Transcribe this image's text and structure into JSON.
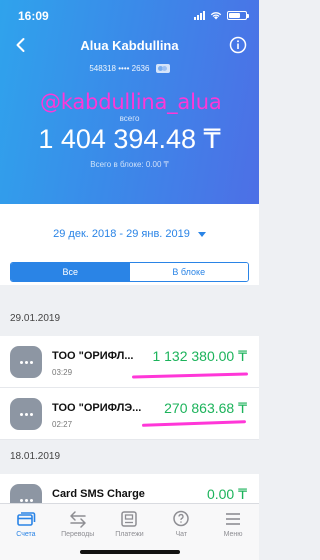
{
  "status_bar": {
    "time": "16:09"
  },
  "header": {
    "title": "Alua Kabdullina",
    "card_number": "548318 •••• 2636",
    "watermark": "@kabdullina_alua",
    "total_label": "всего",
    "balance": "1 404 394.48 ₸",
    "blocked_text": "Всего в блоке: 0.00 ₸"
  },
  "filter": {
    "date_range": "29 дек. 2018 - 29 янв. 2019",
    "segments": [
      "Все",
      "В блоке"
    ],
    "active_segment": 0
  },
  "transactions": {
    "groups": [
      {
        "date": "29.01.2019",
        "items": [
          {
            "name": "ТОО \"ОРИФЛ...",
            "time": "03:29",
            "amount": "1 132 380.00 ₸"
          },
          {
            "name": "ТОО \"ОРИФЛЭ...",
            "time": "02:27",
            "amount": "270 863.68 ₸"
          }
        ]
      },
      {
        "date": "18.01.2019",
        "items": [
          {
            "name": "Card SMS Charge",
            "time": "",
            "amount": "0.00 ₸"
          }
        ]
      }
    ]
  },
  "colors": {
    "accent": "#2a84e6",
    "positive_amount": "#1cb35b",
    "annotation": "#ff37d8"
  },
  "tabbar": {
    "tabs": [
      {
        "label": "Счета",
        "icon": "cards-icon"
      },
      {
        "label": "Переводы",
        "icon": "transfer-arrows-icon"
      },
      {
        "label": "Платежи",
        "icon": "payments-icon"
      },
      {
        "label": "Чат",
        "icon": "chat-icon"
      },
      {
        "label": "Меню",
        "icon": "menu-icon"
      }
    ],
    "active": 0
  }
}
